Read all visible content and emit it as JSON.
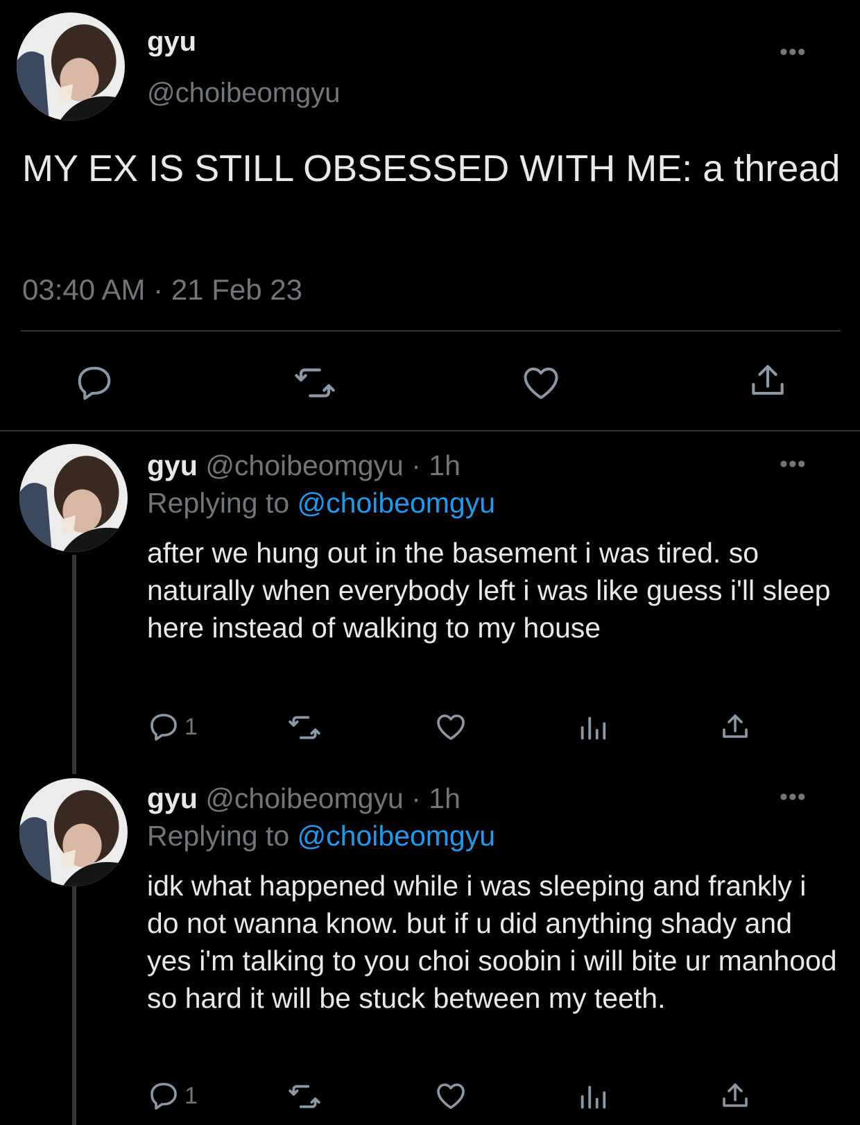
{
  "main_tweet": {
    "name": "gyu",
    "handle": "@choibeomgyu",
    "text": "MY EX IS STILL OBSESSED WITH ME: a thread",
    "time": "03:40 AM",
    "separator": "·",
    "date": "21 Feb 23",
    "more": "•••"
  },
  "replies": [
    {
      "name": "gyu",
      "handle": "@choibeomgyu",
      "sep": "·",
      "age": "1h",
      "replying_label": "Replying to",
      "replying_to": "@choibeomgyu",
      "text": "after we hung out in the basement i was tired. so naturally when everybody left i was like guess i'll sleep here instead of walking to my house",
      "reply_count": "1",
      "more": "•••"
    },
    {
      "name": "gyu",
      "handle": "@choibeomgyu",
      "sep": "·",
      "age": "1h",
      "replying_label": "Replying to",
      "replying_to": "@choibeomgyu",
      "text": "idk what happened while i was sleeping and frankly i do not wanna know. but if u did anything shady and yes i'm talking to you choi soobin i will bite ur manhood so hard it will be stuck between my teeth.",
      "reply_count": "1",
      "more": "•••"
    }
  ],
  "colors": {
    "background": "#000000",
    "text": "#e7e9ea",
    "secondary": "#71767b",
    "link": "#1d9bf0",
    "divider": "#2f3336"
  },
  "icons": [
    "reply-icon",
    "retweet-icon",
    "like-icon",
    "views-icon",
    "share-icon",
    "more-icon"
  ]
}
